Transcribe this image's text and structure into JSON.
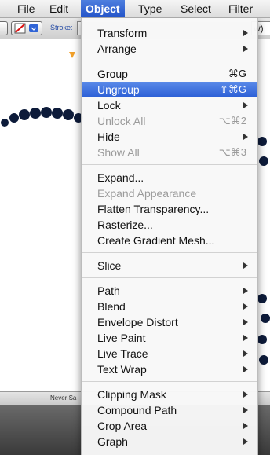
{
  "menubar": {
    "items": [
      {
        "label": "File"
      },
      {
        "label": "Edit"
      },
      {
        "label": "Object"
      },
      {
        "label": "Type"
      },
      {
        "label": "Select"
      },
      {
        "label": "Filter"
      }
    ],
    "active_index": 2
  },
  "control_panel": {
    "stroke_label": "Stroke:",
    "right_field_text": "w)"
  },
  "status_bar": {
    "text": "Never Sa"
  },
  "object_menu": {
    "groups": [
      [
        {
          "label": "Transform",
          "submenu": true
        },
        {
          "label": "Arrange",
          "submenu": true
        }
      ],
      [
        {
          "label": "Group",
          "shortcut": "⌘G"
        },
        {
          "label": "Ungroup",
          "shortcut": "⇧⌘G",
          "highlighted": true
        },
        {
          "label": "Lock",
          "submenu": true
        },
        {
          "label": "Unlock All",
          "shortcut": "⌥⌘2",
          "disabled": true
        },
        {
          "label": "Hide",
          "submenu": true
        },
        {
          "label": "Show All",
          "shortcut": "⌥⌘3",
          "disabled": true
        }
      ],
      [
        {
          "label": "Expand..."
        },
        {
          "label": "Expand Appearance",
          "disabled": true
        },
        {
          "label": "Flatten Transparency..."
        },
        {
          "label": "Rasterize..."
        },
        {
          "label": "Create Gradient Mesh..."
        }
      ],
      [
        {
          "label": "Slice",
          "submenu": true
        }
      ],
      [
        {
          "label": "Path",
          "submenu": true
        },
        {
          "label": "Blend",
          "submenu": true
        },
        {
          "label": "Envelope Distort",
          "submenu": true
        },
        {
          "label": "Live Paint",
          "submenu": true
        },
        {
          "label": "Live Trace",
          "submenu": true
        },
        {
          "label": "Text Wrap",
          "submenu": true
        }
      ],
      [
        {
          "label": "Clipping Mask",
          "submenu": true
        },
        {
          "label": "Compound Path",
          "submenu": true
        },
        {
          "label": "Crop Area",
          "submenu": true
        },
        {
          "label": "Graph",
          "submenu": true
        }
      ]
    ]
  },
  "colors": {
    "highlight": "#2b5ed6",
    "artwork_dots": "#0d1b3a"
  }
}
